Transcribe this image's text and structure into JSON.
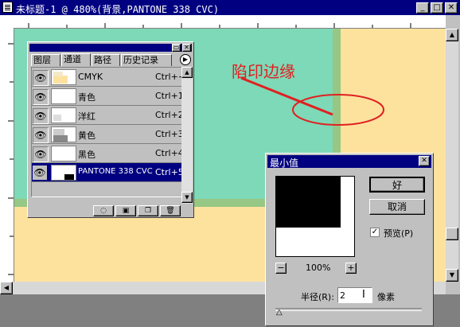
{
  "window": {
    "title": "未标题-1 @ 480%(背景,PANTONE 338 CVC)",
    "minimize": "_",
    "maximize": "□",
    "close": "✕"
  },
  "annotation": {
    "text": "陷印边缘",
    "color": "#e02020"
  },
  "colors": {
    "canvas_background": "#fde29e",
    "cyan_object": "#7dd9b7",
    "trap_edge": "#97c784",
    "title_bar": "#000080"
  },
  "palette": {
    "tabs": [
      "图层",
      "通道",
      "路径",
      "历史记录"
    ],
    "active_tab": "通道",
    "menu_arrow": "▶",
    "channels": [
      {
        "name": "CMYK",
        "shortcut": "Ctrl+~",
        "visible_icon": "eye-icon"
      },
      {
        "name": "青色",
        "shortcut": "Ctrl+1",
        "visible_icon": "eye-icon"
      },
      {
        "name": "洋红",
        "shortcut": "Ctrl+2",
        "visible_icon": "eye-icon"
      },
      {
        "name": "黄色",
        "shortcut": "Ctrl+3",
        "visible_icon": "eye-icon"
      },
      {
        "name": "黑色",
        "shortcut": "Ctrl+4",
        "visible_icon": "eye-icon"
      },
      {
        "name": "PANTONE 338 CVC",
        "shortcut": "Ctrl+5",
        "visible_icon": "eye-icon",
        "selected": true
      }
    ],
    "bottom_icons": [
      "dotted-circle-icon",
      "mask-icon",
      "new-channel-icon",
      "trash-icon"
    ]
  },
  "dialog": {
    "title": "最小值",
    "ok_label": "好",
    "cancel_label": "取消",
    "preview_label": "预览(P)",
    "preview_checked": true,
    "zoom_minus": "−",
    "zoom_plus": "+",
    "zoom_level": "100%",
    "radius_label": "半径(R):",
    "radius_value": "2",
    "unit_label": "像素"
  }
}
